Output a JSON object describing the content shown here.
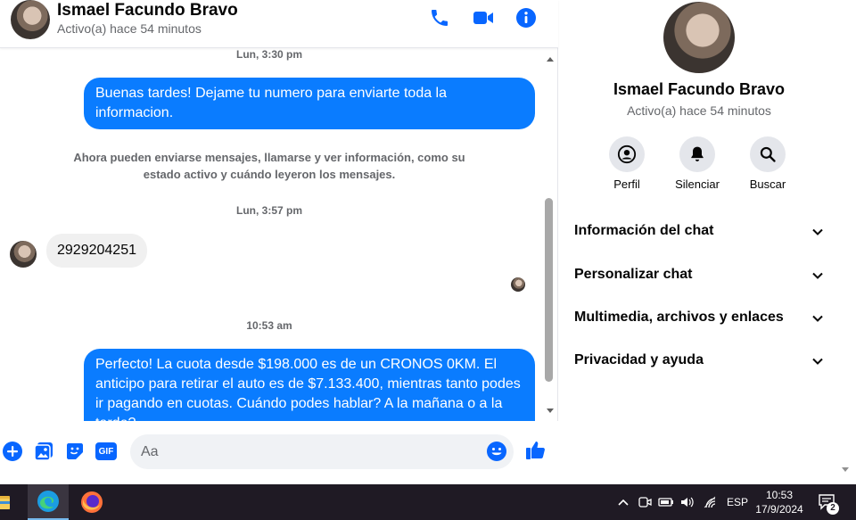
{
  "contact": {
    "name": "Ismael Facundo Bravo",
    "status": "Activo(a) hace 54 minutos"
  },
  "messages": {
    "ts1": "Lun, 3:30 pm",
    "out1": "Buenas tardes! Dejame tu numero para enviarte toda la informacion.",
    "system": "Ahora pueden enviarse mensajes, llamarse y ver información, como su estado activo y cuándo leyeron los mensajes.",
    "ts2": "Lun, 3:57 pm",
    "in1": "2929204251",
    "ts3": "10:53 am",
    "out2": "Perfecto! La cuota desde $198.000 es de un CRONOS 0KM. El anticipo para retirar el auto es de $7.133.400, mientras tanto podes ir pagando en cuotas. Cuándo podes hablar? A la mañana o a la tarde?"
  },
  "composer": {
    "placeholder": "Aa",
    "gif_label": "GIF"
  },
  "panel": {
    "actions": [
      {
        "label": "Perfil",
        "icon": "profile-icon"
      },
      {
        "label": "Silenciar",
        "icon": "bell-icon"
      },
      {
        "label": "Buscar",
        "icon": "search-icon"
      }
    ],
    "sections": [
      "Información del chat",
      "Personalizar chat",
      "Multimedia, archivos y enlaces",
      "Privacidad y ayuda"
    ]
  },
  "taskbar": {
    "language": "ESP",
    "time": "10:53",
    "date": "17/9/2024",
    "notifications": "2"
  },
  "colors": {
    "accent": "#0a7cff",
    "icon_blue": "#0866ff"
  }
}
